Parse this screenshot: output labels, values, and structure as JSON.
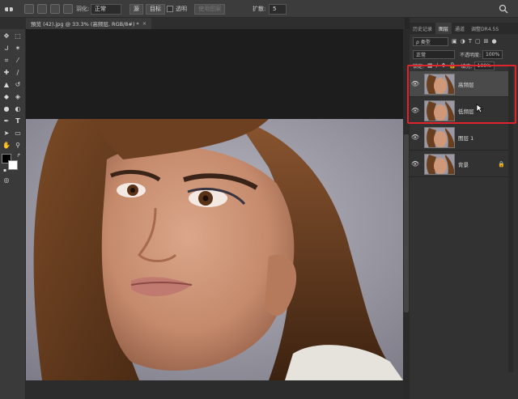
{
  "options_bar": {
    "feather_label": "羽化:",
    "blend_mode": "正常",
    "source_button": "源",
    "target_button": "目标",
    "transparent_label": "透明",
    "use_pattern_button": "使用图案",
    "diffusion_label": "扩散:",
    "diffusion_value": "5"
  },
  "document_tab": {
    "title": "預览 (42).jpg @ 33.3% (高频层, RGB/8#) *",
    "close": "×"
  },
  "panels": {
    "tabs": [
      "历史记录",
      "图层",
      "通道",
      "调整DR4.5S"
    ],
    "active_tab": "图层",
    "filter_kind": "ρ 类型",
    "blend_mode": "正常",
    "opacity_label": "不透明度:",
    "opacity_value": "100%",
    "lock_label": "锁定:",
    "fill_label": "填充:",
    "fill_value": "100%"
  },
  "layers": [
    {
      "name": "高频层",
      "selected": true,
      "visible": true,
      "locked": false
    },
    {
      "name": "低频层",
      "selected": false,
      "visible": true,
      "locked": false
    },
    {
      "name": "图层 1",
      "selected": false,
      "visible": true,
      "locked": false
    },
    {
      "name": "背景",
      "selected": false,
      "visible": true,
      "locked": true
    }
  ],
  "colors": {
    "highlight_box": "#e0242b",
    "foreground": "#000000",
    "background": "#ffffff"
  },
  "icons": [
    "healing-brush-icon",
    "eye-icon",
    "lock-icon",
    "search-icon",
    "move-tool-icon",
    "marquee-tool-icon",
    "lasso-tool-icon",
    "crop-tool-icon",
    "eyedropper-icon",
    "brush-tool-icon",
    "text-tool-icon",
    "zoom-tool-icon"
  ]
}
